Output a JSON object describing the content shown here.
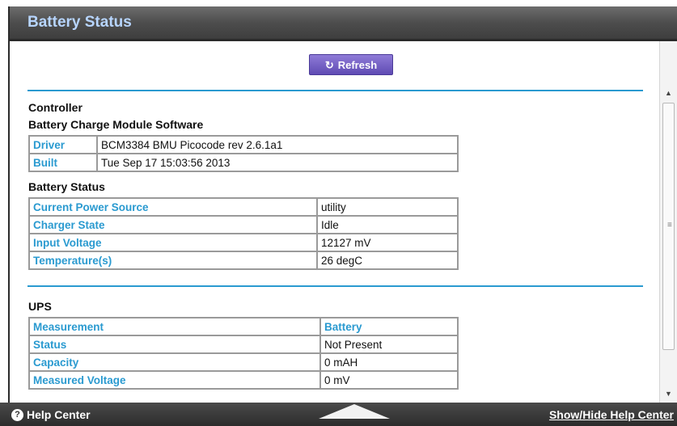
{
  "header": {
    "title": "Battery Status"
  },
  "toolbar": {
    "refresh_label": "Refresh",
    "refresh_icon": "refresh-icon"
  },
  "sections": {
    "controller_label": "Controller",
    "module_label": "Battery Charge Module Software",
    "battery_status_label": "Battery Status",
    "ups_label": "UPS"
  },
  "module_table": [
    {
      "key": "Driver",
      "value": "BCM3384 BMU Picocode rev 2.6.1a1"
    },
    {
      "key": "Built",
      "value": "Tue Sep 17 15:03:56 2013"
    }
  ],
  "battery_table": [
    {
      "key": "Current Power Source",
      "value": "utility"
    },
    {
      "key": "Charger State",
      "value": "Idle"
    },
    {
      "key": "Input Voltage",
      "value": "12127 mV"
    },
    {
      "key": "Temperature(s)",
      "value": "26 degC"
    }
  ],
  "ups_table": {
    "header": {
      "key": "Measurement",
      "value": "Battery"
    },
    "rows": [
      {
        "key": "Status",
        "value": "Not Present"
      },
      {
        "key": "Capacity",
        "value": "0 mAH"
      },
      {
        "key": "Measured Voltage",
        "value": "0 mV"
      }
    ]
  },
  "footer": {
    "help_label": "Help Center",
    "toggle_label": "Show/Hide Help Center"
  },
  "colors": {
    "accent": "#2a9ad0",
    "title": "#b7d5ff",
    "button": "#6f5cc4"
  }
}
